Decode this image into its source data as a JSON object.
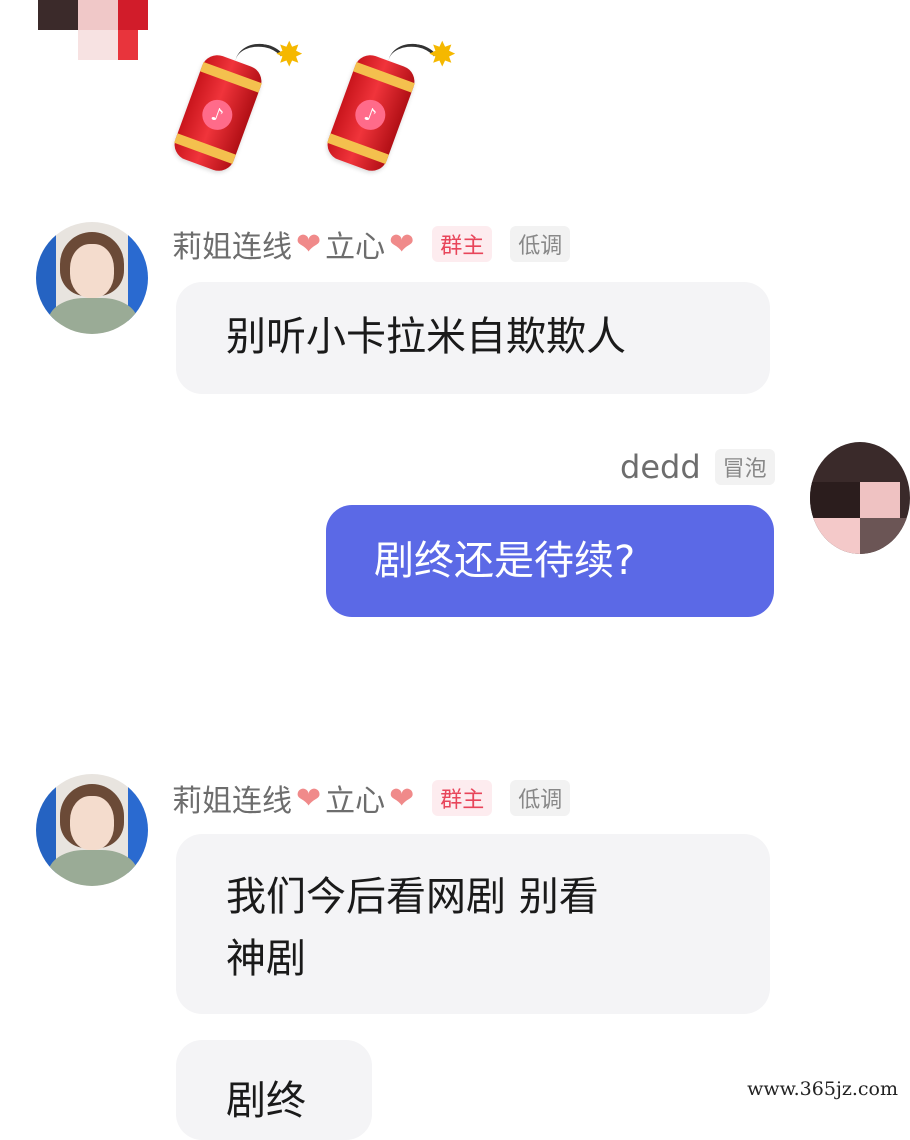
{
  "messages": [
    {
      "sender": "莉姐连线",
      "sender_suffix": "立心",
      "badge_role": "群主",
      "badge_status": "低调",
      "text": "别听小卡拉米自欺欺人"
    },
    {
      "sender": "dedd",
      "badge_status": "冒泡",
      "text": "剧终还是待续?"
    },
    {
      "sender": "莉姐连线",
      "sender_suffix": "立心",
      "badge_role": "群主",
      "badge_status": "低调",
      "text_line1": "我们今后看网剧 别看",
      "text_line2": "神剧",
      "text2": "剧终"
    }
  ],
  "sticker_glyph": "♪",
  "heart_glyph": "❤",
  "watermark": "www.365jz.com",
  "colors": {
    "outgoing_bubble": "#5b69e6",
    "incoming_bubble": "#f4f4f6",
    "owner_badge": "#e8455a"
  }
}
